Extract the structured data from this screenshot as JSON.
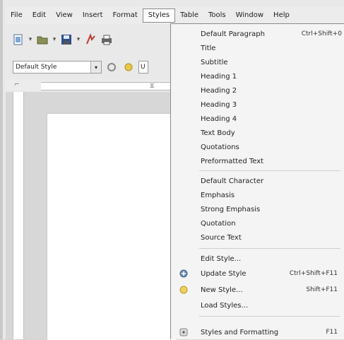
{
  "menubar": {
    "items": [
      "File",
      "Edit",
      "View",
      "Insert",
      "Format",
      "Styles",
      "Table",
      "Tools",
      "Window",
      "Help"
    ],
    "active": "Styles"
  },
  "formatting_toolbar": {
    "paragraph_style": "Default Style",
    "cut_off_text": "U"
  },
  "styles_menu": {
    "paragraph_styles": [
      {
        "label": "Default Paragraph",
        "shortcut": "Ctrl+Shift+0"
      },
      {
        "label": "Title",
        "shortcut": ""
      },
      {
        "label": "Subtitle",
        "shortcut": ""
      },
      {
        "label": "Heading 1",
        "shortcut": ""
      },
      {
        "label": "Heading 2",
        "shortcut": ""
      },
      {
        "label": "Heading 3",
        "shortcut": ""
      },
      {
        "label": "Heading 4",
        "shortcut": ""
      },
      {
        "label": "Text Body",
        "shortcut": ""
      },
      {
        "label": "Quotations",
        "shortcut": ""
      },
      {
        "label": "Preformatted Text",
        "shortcut": ""
      }
    ],
    "character_styles": [
      {
        "label": "Default Character",
        "shortcut": ""
      },
      {
        "label": "Emphasis",
        "shortcut": ""
      },
      {
        "label": "Strong Emphasis",
        "shortcut": ""
      },
      {
        "label": "Quotation",
        "shortcut": ""
      },
      {
        "label": "Source Text",
        "shortcut": ""
      }
    ],
    "style_actions": [
      {
        "label": "Edit Style...",
        "shortcut": "",
        "icon": ""
      },
      {
        "label": "Update Style",
        "shortcut": "Ctrl+Shift+F11",
        "icon": "update-style-icon"
      },
      {
        "label": "New Style...",
        "shortcut": "Shift+F11",
        "icon": "new-style-icon"
      },
      {
        "label": "Load Styles...",
        "shortcut": "",
        "icon": ""
      }
    ],
    "sidebar_action": {
      "label": "Styles and Formatting",
      "shortcut": "F11",
      "icon": "styles-formatting-icon"
    }
  },
  "colors": {
    "menu_background": "#f4f4f4",
    "menu_border": "#8a8a8a",
    "window_background": "#e9e9e9",
    "document_background": "#d7d7d7"
  }
}
